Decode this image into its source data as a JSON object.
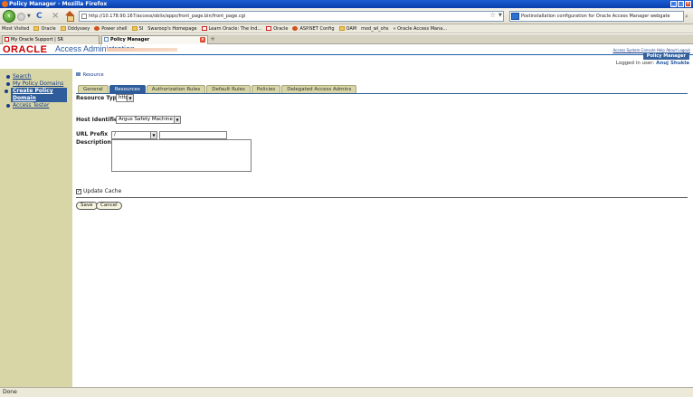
{
  "window": {
    "title": "Policy Manager - Mozilla Firefox",
    "buttons": [
      "_",
      "□",
      "×"
    ]
  },
  "navbar": {
    "back_icon": "back-arrow-icon",
    "url": "http://10.178.90.167/access/oblix/apps/front_page.bin/front_page.cgi",
    "search_text": "Postinstallation configuration for Oracle Access Manager webgate"
  },
  "bookmarks": [
    {
      "label": "Most Visited",
      "icon": "page"
    },
    {
      "label": "Oracle",
      "icon": "folder"
    },
    {
      "label": "Oddyssey",
      "icon": "folder"
    },
    {
      "label": "Power shell",
      "icon": "orange"
    },
    {
      "label": "SI",
      "icon": "folder"
    },
    {
      "label": "Swaroop's Homepage",
      "icon": "page"
    },
    {
      "label": "Learn Oracle: The Ind...",
      "icon": "red"
    },
    {
      "label": "Oracle",
      "icon": "red"
    },
    {
      "label": "ASP.NET Config",
      "icon": "orange"
    },
    {
      "label": "OAM",
      "icon": "folder"
    },
    {
      "label": "mod_wl_ohs",
      "icon": "page"
    },
    {
      "label": "« Oracle Access Mana...",
      "icon": "page"
    }
  ],
  "tabs": [
    {
      "label": "My Oracle Support | SR",
      "active": false
    },
    {
      "label": "Policy Manager",
      "active": true
    }
  ],
  "header": {
    "logo": "ORACLE",
    "app_title": "Access Administration",
    "top_links": "Access System Console Help About Logout",
    "policy_manager_button": "Policy Manager",
    "logged_in_label": "Logged in user:",
    "logged_in_user": "Anuj Shukla"
  },
  "sidebar": {
    "items": [
      {
        "label": "Search",
        "active": false
      },
      {
        "label": "My Policy Domains",
        "active": false
      },
      {
        "label": "Create Policy Domain",
        "active": true
      },
      {
        "label": "Access Tester",
        "active": false
      }
    ]
  },
  "content": {
    "breadcrumb": "Resource",
    "subtabs": [
      {
        "label": "General",
        "active": false
      },
      {
        "label": "Resources",
        "active": true
      },
      {
        "label": "Authorization Rules",
        "active": false
      },
      {
        "label": "Default Rules",
        "active": false
      },
      {
        "label": "Policies",
        "active": false
      },
      {
        "label": "Delegated Access Admins",
        "active": false
      }
    ],
    "resource_type_label": "Resource Type",
    "resource_type_value": "http",
    "host_identifiers_label": "Host Identifiers",
    "host_identifiers_value": "Argus Safety Machine",
    "url_prefix_label": "URL Prefix",
    "url_prefix_value": "/",
    "url_prefix_text": "",
    "description_label": "Description",
    "description_value": "",
    "update_cache_label": "Update Cache",
    "update_cache_checked": true,
    "save_label": "Save",
    "cancel_label": "Cancel"
  },
  "status": {
    "text": "Done"
  }
}
